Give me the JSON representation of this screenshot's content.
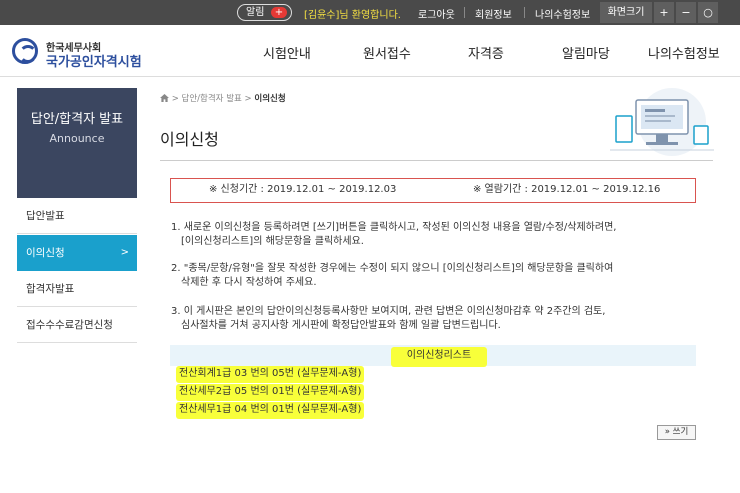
{
  "topbar": {
    "alarm_label": "알림",
    "alarm_plus": "+",
    "welcome": "[김윤수]님 환영합니다.",
    "logout": "로그아웃",
    "member_info": "회원정보",
    "my_exam": "나의수험정보",
    "screen_size": "화면크기",
    "zoom_in": "+",
    "zoom_out": "−",
    "zoom_reset": "○"
  },
  "header": {
    "logo_top": "한국세무사회",
    "logo_main": "국가공인자격시험",
    "nav": [
      "시험안내",
      "원서접수",
      "자격증",
      "알림마당",
      "나의수험정보"
    ]
  },
  "sidebar": {
    "title": "답안/합격자 발표",
    "subtitle": "Announce",
    "items": [
      {
        "label": "답안발표"
      },
      {
        "label": "이의신청",
        "arrow": ">"
      },
      {
        "label": "합격자발표"
      },
      {
        "label": "접수수수료감면신청"
      }
    ]
  },
  "breadcrumb": {
    "home_icon": "home-icon",
    "path": "> 답안/합격자 발표 >",
    "current": "이의신청"
  },
  "page": {
    "title": "이의신청",
    "period_apply": "※ 신청기간 : 2019.12.01 ~ 2019.12.03",
    "period_view": "※ 열람기간 : 2019.12.01 ~ 2019.12.16",
    "notices": [
      [
        "1. 새로운 이의신청을 등록하려면 [쓰기]버튼을 클릭하시고, 작성된 이의신청 내용을 열람/수정/삭제하려면,",
        "[이의신청리스트]의 해당문항을 클릭하세요."
      ],
      [
        "2. \"종목/문항/유형\"을 잘못 작성한 경우에는 수정이 되지 않으니 [이의신청리스트]의 해당문항을 클릭하여",
        "삭제한 후 다시 작성하여 주세요."
      ],
      [
        "3. 이 게시판은 본인의 답안이의신청등록사항만 보여지며, 관련 답변은 이의신청마감후 약 2주간의 검토,",
        "심사절차를 거쳐 공지사항 게시판에 확정답안발표와 함께 일괄 답변드립니다."
      ]
    ],
    "list_title": "이의신청리스트",
    "entries": [
      "전산회계1급 03 번의 05번 (실무문제-A형)",
      "전산세무2급 05 번의 01번 (실무문제-A형)",
      "전산세무1급 04 번의 01번 (실무문제-A형)"
    ],
    "write_button": "» 쓰기"
  },
  "colors": {
    "topbar_bg": "#4a4a4a",
    "brand_blue": "#2d4f9e",
    "sidebar_head": "#3b4660",
    "active_item": "#1aa0cc",
    "highlight": "#f8ff3a",
    "period_border": "#d9534f"
  }
}
